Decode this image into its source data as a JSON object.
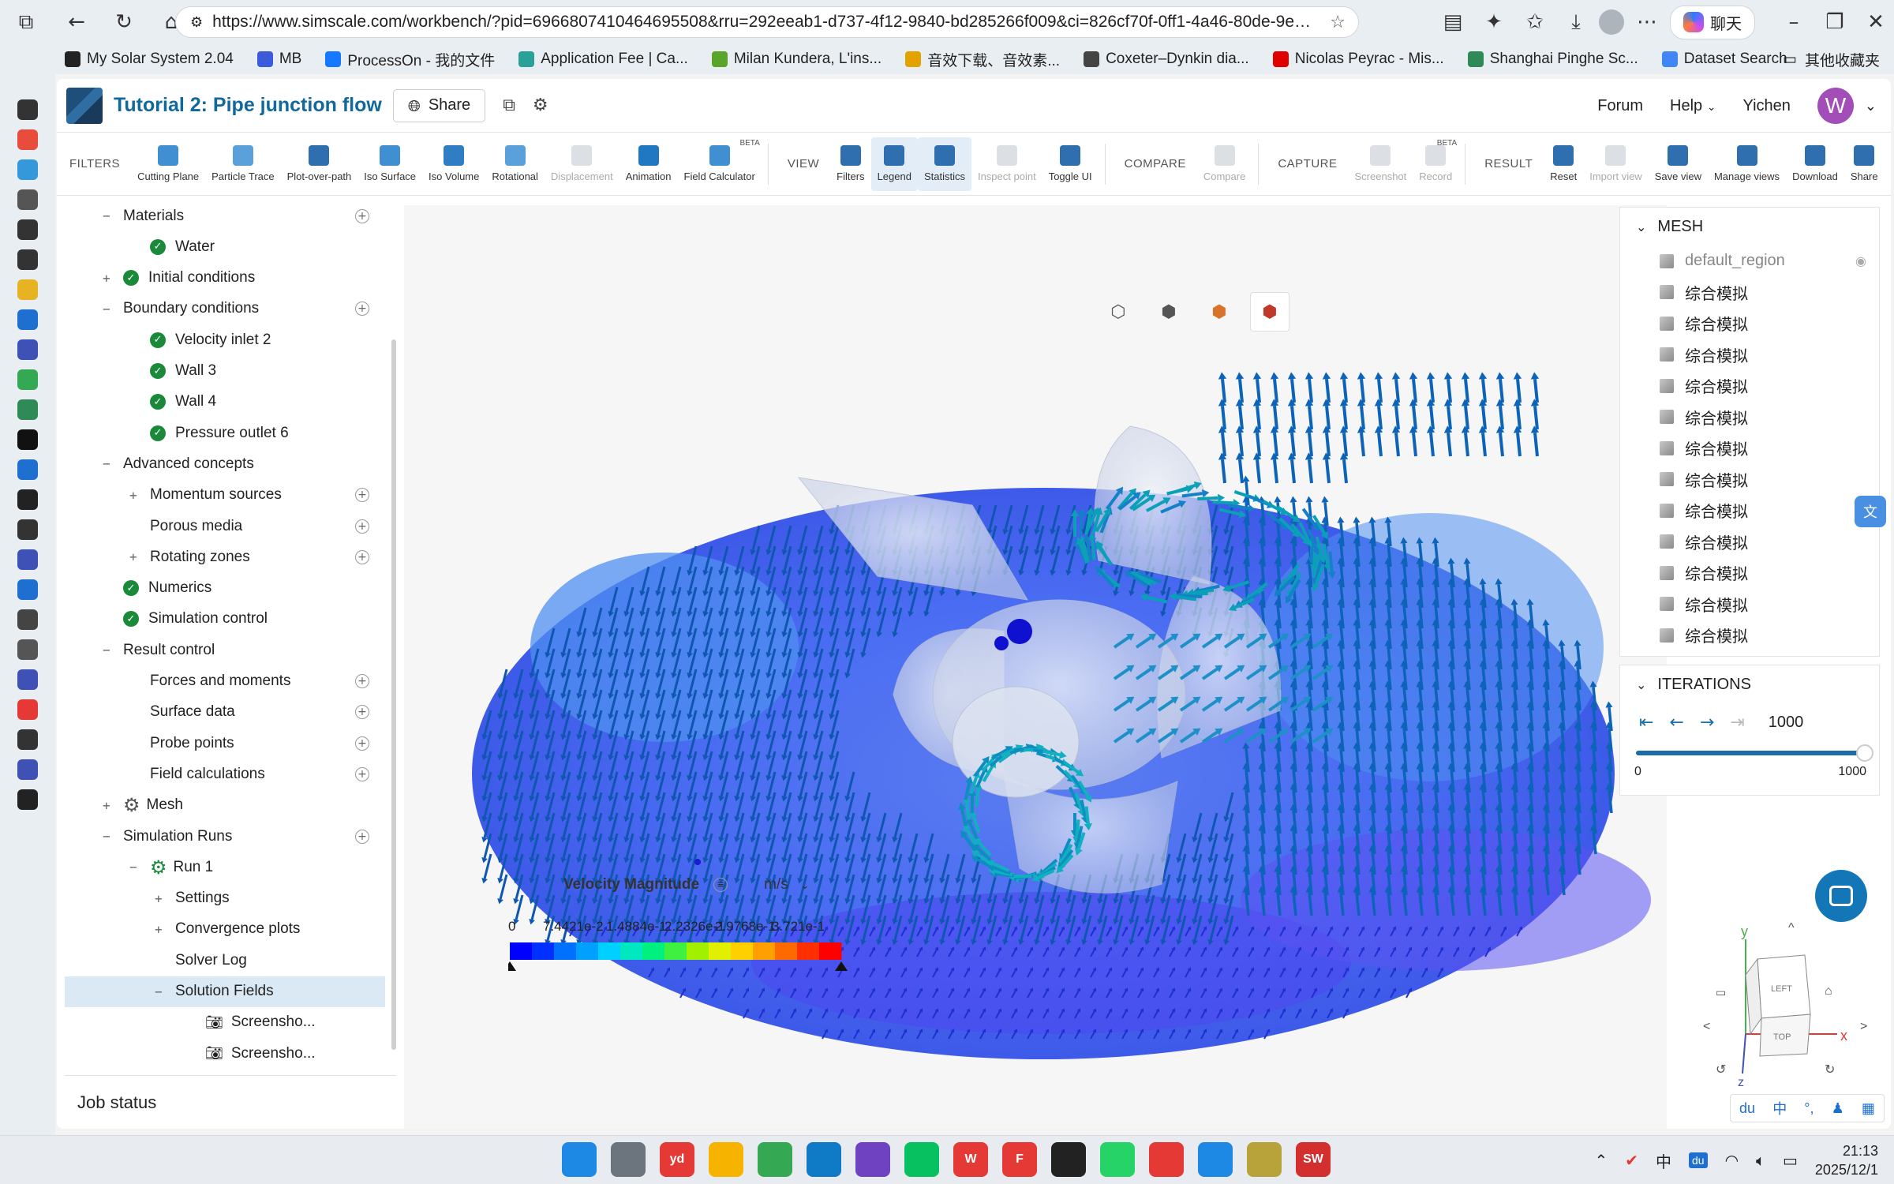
{
  "browser": {
    "url": "https://www.simscale.com/workbench/?pid=6966807410464695508&rru=292eeab1-d737-4f12-9840-bd285266f009&ci=826cf70f-0ff1-4a46-80de-9e6d629082...",
    "chat_label": "聊天",
    "bookmarks": [
      {
        "label": "My Solar System 2.04",
        "color": "#222222"
      },
      {
        "label": "MB",
        "color": "#3b5bdb"
      },
      {
        "label": "ProcessOn - 我的文件",
        "color": "#1677ff"
      },
      {
        "label": "Application Fee | Ca...",
        "color": "#2aa198"
      },
      {
        "label": "Milan Kundera, L'ins...",
        "color": "#59a52c"
      },
      {
        "label": "音效下载、音效素...",
        "color": "#e2a300"
      },
      {
        "label": "Coxeter–Dynkin dia...",
        "color": "#444444"
      },
      {
        "label": "Nicolas Peyrac - Mis...",
        "color": "#e00000"
      },
      {
        "label": "Shanghai Pinghe Sc...",
        "color": "#2e8b57"
      },
      {
        "label": "Dataset Search",
        "color": "#4285f4"
      }
    ],
    "other_bookmarks": "其他收藏夹"
  },
  "app": {
    "title": "Tutorial 2: Pipe junction flow",
    "share_label": "Share",
    "forum": "Forum",
    "help": "Help",
    "user_name": "Yichen",
    "user_initial": "W"
  },
  "toolbar": {
    "filters_section": "FILTERS",
    "view_section": "VIEW",
    "compare_section": "COMPARE",
    "capture_section": "CAPTURE",
    "result_section": "RESULT",
    "filters": [
      {
        "label": "Cutting Plane",
        "color": "#3f8fd2",
        "disabled": false,
        "beta": false
      },
      {
        "label": "Particle Trace",
        "color": "#5aa0db",
        "disabled": false,
        "beta": false
      },
      {
        "label": "Plot-over-path",
        "color": "#2f6fb0",
        "disabled": false,
        "beta": false
      },
      {
        "label": "Iso Surface",
        "color": "#3f8fd2",
        "disabled": false,
        "beta": false
      },
      {
        "label": "Iso Volume",
        "color": "#2f7ec4",
        "disabled": false,
        "beta": false
      },
      {
        "label": "Rotational",
        "color": "#5aa0db",
        "disabled": false,
        "beta": false
      },
      {
        "label": "Displacement",
        "color": "#9aa6b2",
        "disabled": true,
        "beta": false
      },
      {
        "label": "Animation",
        "color": "#1f78c1",
        "disabled": false,
        "beta": false
      },
      {
        "label": "Field Calculator",
        "color": "#3f8fd2",
        "disabled": false,
        "beta": true
      }
    ],
    "view": [
      {
        "label": "Filters",
        "color": "#2f6fb0",
        "disabled": false,
        "active": false
      },
      {
        "label": "Legend",
        "color": "#2f6fb0",
        "disabled": false,
        "active": true
      },
      {
        "label": "Statistics",
        "color": "#2f6fb0",
        "disabled": false,
        "active": true
      },
      {
        "label": "Inspect point",
        "color": "#9aa6b2",
        "disabled": true,
        "active": false
      },
      {
        "label": "Toggle UI",
        "color": "#2f6fb0",
        "disabled": false,
        "active": false
      }
    ],
    "compare": [
      {
        "label": "Compare",
        "color": "#9aa6b2",
        "disabled": true
      }
    ],
    "capture": [
      {
        "label": "Screenshot",
        "color": "#9aa6b2",
        "disabled": true,
        "beta": false
      },
      {
        "label": "Record",
        "color": "#9aa6b2",
        "disabled": true,
        "beta": true
      }
    ],
    "result": [
      {
        "label": "Reset",
        "color": "#2f6fb0",
        "disabled": false
      },
      {
        "label": "Import view",
        "color": "#9aa6b2",
        "disabled": true
      },
      {
        "label": "Save view",
        "color": "#2f6fb0",
        "disabled": false
      },
      {
        "label": "Manage views",
        "color": "#2f6fb0",
        "disabled": false
      },
      {
        "label": "Download",
        "color": "#2f6fb0",
        "disabled": false
      },
      {
        "label": "Share",
        "color": "#2f6fb0",
        "disabled": false
      }
    ],
    "beta_label": "BETA"
  },
  "tree": [
    {
      "label": "Materials",
      "indent": 1,
      "expander": "−",
      "check": false,
      "plus": true
    },
    {
      "label": "Water",
      "indent": 2,
      "expander": "",
      "check": true,
      "plus": false
    },
    {
      "label": "Initial conditions",
      "indent": 1,
      "expander": "+",
      "check": true,
      "plus": false
    },
    {
      "label": "Boundary conditions",
      "indent": 1,
      "expander": "−",
      "check": false,
      "plus": true
    },
    {
      "label": "Velocity inlet 2",
      "indent": 2,
      "expander": "",
      "check": true,
      "plus": false
    },
    {
      "label": "Wall 3",
      "indent": 2,
      "expander": "",
      "check": true,
      "plus": false
    },
    {
      "label": "Wall 4",
      "indent": 2,
      "expander": "",
      "check": true,
      "plus": false
    },
    {
      "label": "Pressure outlet 6",
      "indent": 2,
      "expander": "",
      "check": true,
      "plus": false
    },
    {
      "label": "Advanced concepts",
      "indent": 1,
      "expander": "−",
      "check": false,
      "plus": false
    },
    {
      "label": "Momentum sources",
      "indent": 2,
      "expander": "+",
      "check": false,
      "plus": true
    },
    {
      "label": "Porous media",
      "indent": 2,
      "expander": "",
      "check": false,
      "plus": true
    },
    {
      "label": "Rotating zones",
      "indent": 2,
      "expander": "+",
      "check": false,
      "plus": true
    },
    {
      "label": "Numerics",
      "indent": 1,
      "expander": "",
      "check": true,
      "plus": false
    },
    {
      "label": "Simulation control",
      "indent": 1,
      "expander": "",
      "check": true,
      "plus": false
    },
    {
      "label": "Result control",
      "indent": 1,
      "expander": "−",
      "check": false,
      "plus": false
    },
    {
      "label": "Forces and moments",
      "indent": 2,
      "expander": "",
      "check": false,
      "plus": true
    },
    {
      "label": "Surface data",
      "indent": 2,
      "expander": "",
      "check": false,
      "plus": true
    },
    {
      "label": "Probe points",
      "indent": 2,
      "expander": "",
      "check": false,
      "plus": true
    },
    {
      "label": "Field calculations",
      "indent": 2,
      "expander": "",
      "check": false,
      "plus": true
    },
    {
      "label": "Mesh",
      "indent": 1,
      "expander": "+",
      "check": false,
      "plus": false,
      "mesh": true
    },
    {
      "label": "Simulation Runs",
      "indent": 1,
      "expander": "−",
      "check": false,
      "plus": true
    },
    {
      "label": "Run 1",
      "indent": 2,
      "expander": "−",
      "check": false,
      "plus": false,
      "gear": true
    },
    {
      "label": "Settings",
      "indent": 3,
      "expander": "+",
      "check": false,
      "plus": false
    },
    {
      "label": "Convergence plots",
      "indent": 3,
      "expander": "+",
      "check": false,
      "plus": false
    },
    {
      "label": "Solver Log",
      "indent": 3,
      "expander": "",
      "check": false,
      "plus": false
    },
    {
      "label": "Solution Fields",
      "indent": 3,
      "expander": "−",
      "check": false,
      "plus": false,
      "selected": true
    },
    {
      "label": "Screensho...",
      "indent": 4,
      "expander": "",
      "check": false,
      "plus": false,
      "camera": true
    },
    {
      "label": "Screensho...",
      "indent": 4,
      "expander": "",
      "check": false,
      "plus": false,
      "camera": true
    }
  ],
  "job_status": "Job status",
  "legend": {
    "title": "Velocity Magnitude",
    "unit": "m/s",
    "ticks": [
      "0",
      "7.4421e-2",
      "1.4884e-1",
      "2.2326e-1",
      "2.9768e-1",
      "3.721e-1"
    ]
  },
  "mesh_panel": {
    "title": "MESH",
    "items": [
      {
        "label": "default_region",
        "dim": true,
        "eye": true
      },
      {
        "label": "综合模拟",
        "dim": false,
        "eye": false
      },
      {
        "label": "综合模拟",
        "dim": false,
        "eye": false
      },
      {
        "label": "综合模拟",
        "dim": false,
        "eye": false
      },
      {
        "label": "综合模拟",
        "dim": false,
        "eye": false
      },
      {
        "label": "综合模拟",
        "dim": false,
        "eye": false
      },
      {
        "label": "综合模拟",
        "dim": false,
        "eye": false
      },
      {
        "label": "综合模拟",
        "dim": false,
        "eye": false
      },
      {
        "label": "综合模拟",
        "dim": false,
        "eye": false
      },
      {
        "label": "综合模拟",
        "dim": false,
        "eye": false
      },
      {
        "label": "综合模拟",
        "dim": false,
        "eye": false
      },
      {
        "label": "综合模拟",
        "dim": false,
        "eye": false
      },
      {
        "label": "综合模拟",
        "dim": false,
        "eye": false
      }
    ]
  },
  "iterations": {
    "title": "ITERATIONS",
    "value": "1000",
    "min": "0",
    "max": "1000",
    "progress": 1.0
  },
  "navcube": {
    "y_label": "y",
    "x_label": "x",
    "z_label": "z",
    "left_face": "LEFT",
    "top_face": "TOP"
  },
  "taskbar": {
    "apps": [
      {
        "name": "start",
        "color": "#1e88e5",
        "text": ""
      },
      {
        "name": "task-view",
        "color": "#6c757d",
        "text": ""
      },
      {
        "name": "youdao",
        "color": "#e53935",
        "text": "yd"
      },
      {
        "name": "file-explorer",
        "color": "#f6b400",
        "text": ""
      },
      {
        "name": "chrome",
        "color": "#34a853",
        "text": ""
      },
      {
        "name": "edge",
        "color": "#0f7ac6",
        "text": ""
      },
      {
        "name": "visual-studio",
        "color": "#6f42c1",
        "text": ""
      },
      {
        "name": "wechat",
        "color": "#07c160",
        "text": ""
      },
      {
        "name": "wps",
        "color": "#e53935",
        "text": "W"
      },
      {
        "name": "foxit",
        "color": "#e53935",
        "text": "F"
      },
      {
        "name": "qq",
        "color": "#222222",
        "text": ""
      },
      {
        "name": "whatsapp",
        "color": "#25d366",
        "text": ""
      },
      {
        "name": "netease-music",
        "color": "#e53935",
        "text": ""
      },
      {
        "name": "todo",
        "color": "#1e88e5",
        "text": ""
      },
      {
        "name": "game",
        "color": "#b8a23a",
        "text": ""
      },
      {
        "name": "solidworks",
        "color": "#d32f2f",
        "text": "SW"
      }
    ],
    "ime": "中",
    "time": "21:13",
    "date": "2025/12/1"
  },
  "colors": {
    "accent": "#11699b",
    "check_green": "#1a8a3a",
    "selected_row": "#dbe9f5"
  }
}
